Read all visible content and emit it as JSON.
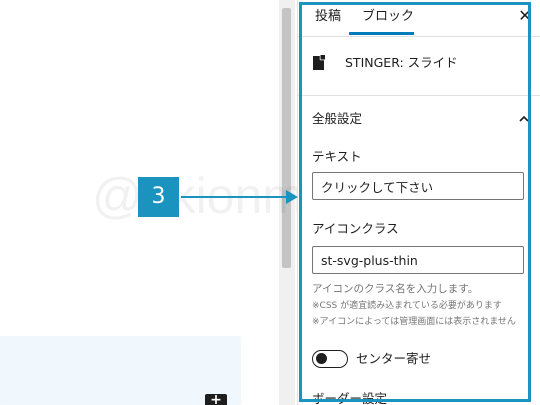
{
  "tabs": [
    {
      "label": "投稿"
    },
    {
      "label": "ブロック"
    }
  ],
  "close_icon": "close-icon",
  "block": {
    "name": "STINGER: スライド",
    "icon": "document-icon"
  },
  "panel": {
    "title": "全般設定"
  },
  "fields": {
    "text_label": "テキスト",
    "text_value": "クリックして下さい",
    "icon_label": "アイコンクラス",
    "icon_value": "st-svg-plus-thin",
    "help": "アイコンのクラス名を入力します。",
    "note1": "※CSS が適宜読み込まれている必要があります",
    "note2": "※アイコンによっては管理画面には表示されません"
  },
  "toggle": {
    "label": "センター寄せ",
    "state": "off"
  },
  "next_section": "ボーダー設定",
  "annotation": {
    "step": "3",
    "color": "#1a93be"
  },
  "watermark": "@akionma"
}
